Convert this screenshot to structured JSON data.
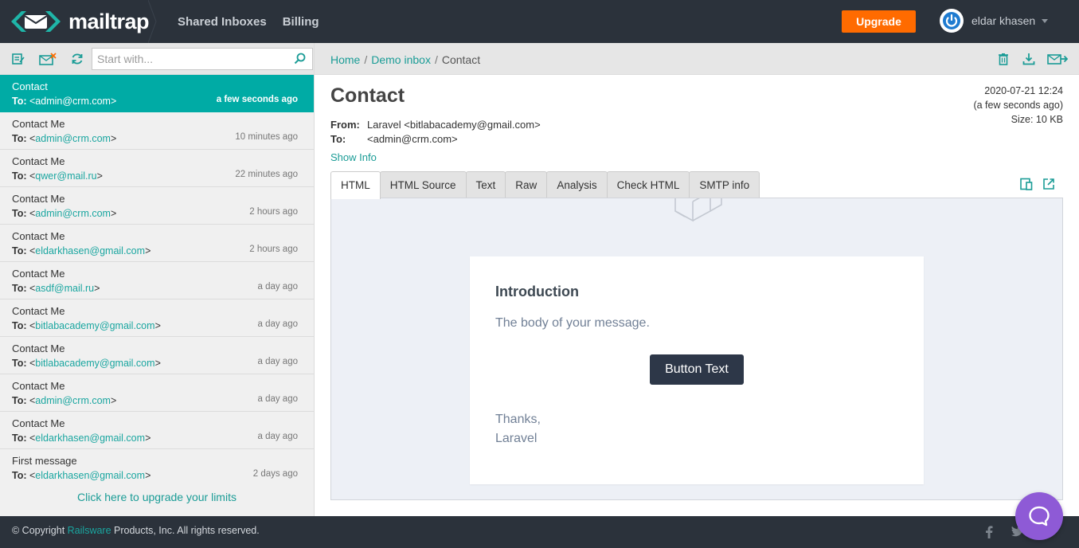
{
  "app": {
    "brand": "mailtrap"
  },
  "nav": {
    "shared_inboxes": "Shared Inboxes",
    "billing": "Billing"
  },
  "header": {
    "upgrade": "Upgrade",
    "user_name": "eldar khasen"
  },
  "search": {
    "placeholder": "Start with..."
  },
  "messages": [
    {
      "subject": "Contact",
      "to_label": "To:",
      "to": "admin@crm.com",
      "time": "a few seconds ago",
      "active": true
    },
    {
      "subject": "Contact Me",
      "to_label": "To:",
      "to": "admin@crm.com",
      "time": "10 minutes ago"
    },
    {
      "subject": "Contact Me",
      "to_label": "To:",
      "to": "qwer@mail.ru",
      "time": "22 minutes ago"
    },
    {
      "subject": "Contact Me",
      "to_label": "To:",
      "to": "admin@crm.com",
      "time": "2 hours ago"
    },
    {
      "subject": "Contact Me",
      "to_label": "To:",
      "to": "eldarkhasen@gmail.com",
      "time": "2 hours ago"
    },
    {
      "subject": "Contact Me",
      "to_label": "To:",
      "to": "asdf@mail.ru",
      "time": "a day ago"
    },
    {
      "subject": "Contact Me",
      "to_label": "To:",
      "to": "bitlabacademy@gmail.com",
      "time": "a day ago"
    },
    {
      "subject": "Contact Me",
      "to_label": "To:",
      "to": "bitlabacademy@gmail.com",
      "time": "a day ago"
    },
    {
      "subject": "Contact Me",
      "to_label": "To:",
      "to": "admin@crm.com",
      "time": "a day ago"
    },
    {
      "subject": "Contact Me",
      "to_label": "To:",
      "to": "eldarkhasen@gmail.com",
      "time": "a day ago"
    },
    {
      "subject": "First message",
      "to_label": "To:",
      "to": "eldarkhasen@gmail.com",
      "time": "2 days ago"
    }
  ],
  "upgrade_limits": "Click here to upgrade your limits",
  "breadcrumb": {
    "home": "Home",
    "inbox": "Demo inbox",
    "current": "Contact"
  },
  "email": {
    "subject": "Contact",
    "from_label": "From:",
    "from": "Laravel <bitlabacademy@gmail.com>",
    "to_label": "To:",
    "to": "<admin@crm.com>",
    "date": "2020-07-21 12:24",
    "relative": "(a few seconds ago)",
    "size": "Size: 10 KB",
    "show_info": "Show Info"
  },
  "tabs": [
    "HTML",
    "HTML Source",
    "Text",
    "Raw",
    "Analysis",
    "Check HTML",
    "SMTP info"
  ],
  "preview": {
    "heading": "Introduction",
    "body": "The body of your message.",
    "button": "Button Text",
    "thanks": "Thanks,",
    "signature": "Laravel"
  },
  "footer": {
    "prefix": "© Copyright ",
    "company": "Railsware",
    "suffix": " Products, Inc. All rights reserved."
  },
  "colors": {
    "accent": "#00aba5",
    "topbar": "#2b323b",
    "upgrade": "#ff6b00",
    "help": "#8e5ad6"
  }
}
